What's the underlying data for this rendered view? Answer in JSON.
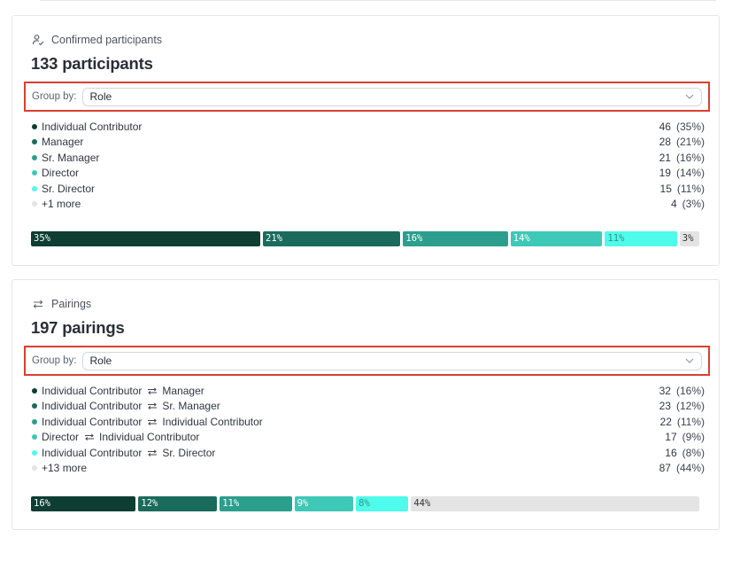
{
  "colors": {
    "c1": "#0d3d33",
    "c2": "#1a6b5c",
    "c3": "#2b9e8c",
    "c4": "#3ec8b7",
    "c5": "#4ffbea",
    "c6": "#e4e4e4"
  },
  "participants": {
    "header_icon": "user-check-icon",
    "header": "Confirmed participants",
    "title": "133 participants",
    "group_by_label": "Group by:",
    "group_by_value": "Role",
    "rows": [
      {
        "label": "Individual Contributor",
        "count": "46",
        "pct": "(35%)",
        "color": "#0d3d33"
      },
      {
        "label": "Manager",
        "count": "28",
        "pct": "(21%)",
        "color": "#1a6b5c"
      },
      {
        "label": "Sr. Manager",
        "count": "21",
        "pct": "(16%)",
        "color": "#2b9e8c"
      },
      {
        "label": "Director",
        "count": "19",
        "pct": "(14%)",
        "color": "#3ec8b7"
      },
      {
        "label": "Sr. Director",
        "count": "15",
        "pct": "(11%)",
        "color": "#4ffbea"
      },
      {
        "label": "+1 more",
        "count": "4",
        "pct": "(3%)",
        "color": "#e4e4e4"
      }
    ],
    "bar": [
      {
        "label": "35%",
        "value": 35,
        "color": "#0d3d33",
        "text": "#ffffff"
      },
      {
        "label": "21%",
        "value": 21,
        "color": "#1a6b5c",
        "text": "#ffffff"
      },
      {
        "label": "16%",
        "value": 16,
        "color": "#2b9e8c",
        "text": "#ffffff"
      },
      {
        "label": "14%",
        "value": 14,
        "color": "#3ec8b7",
        "text": "#ffffff"
      },
      {
        "label": "11%",
        "value": 11,
        "color": "#4ffbea",
        "text": "#3a8f86"
      },
      {
        "label": "3%",
        "value": 3,
        "color": "#e4e4e4",
        "text": "#333333"
      }
    ]
  },
  "pairings": {
    "header_icon": "swap-arrows-icon",
    "header": "Pairings",
    "title": "197 pairings",
    "group_by_label": "Group by:",
    "group_by_value": "Role",
    "rows": [
      {
        "a": "Individual Contributor",
        "b": "Manager",
        "count": "32",
        "pct": "(16%)",
        "color": "#0d3d33"
      },
      {
        "a": "Individual Contributor",
        "b": "Sr. Manager",
        "count": "23",
        "pct": "(12%)",
        "color": "#1a6b5c"
      },
      {
        "a": "Individual Contributor",
        "b": "Individual Contributor",
        "count": "22",
        "pct": "(11%)",
        "color": "#2b9e8c"
      },
      {
        "a": "Director",
        "b": "Individual Contributor",
        "count": "17",
        "pct": "(9%)",
        "color": "#3ec8b7"
      },
      {
        "a": "Individual Contributor",
        "b": "Sr. Director",
        "count": "16",
        "pct": "(8%)",
        "color": "#4ffbea"
      },
      {
        "a": "+13 more",
        "b": "",
        "count": "87",
        "pct": "(44%)",
        "color": "#e4e4e4"
      }
    ],
    "bar": [
      {
        "label": "16%",
        "value": 16,
        "color": "#0d3d33",
        "text": "#ffffff"
      },
      {
        "label": "12%",
        "value": 12,
        "color": "#1a6b5c",
        "text": "#ffffff"
      },
      {
        "label": "11%",
        "value": 11,
        "color": "#2b9e8c",
        "text": "#ffffff"
      },
      {
        "label": "9%",
        "value": 9,
        "color": "#3ec8b7",
        "text": "#ffffff"
      },
      {
        "label": "8%",
        "value": 8,
        "color": "#4ffbea",
        "text": "#3a8f86"
      },
      {
        "label": "44%",
        "value": 44,
        "color": "#e4e4e4",
        "text": "#333333"
      }
    ]
  }
}
